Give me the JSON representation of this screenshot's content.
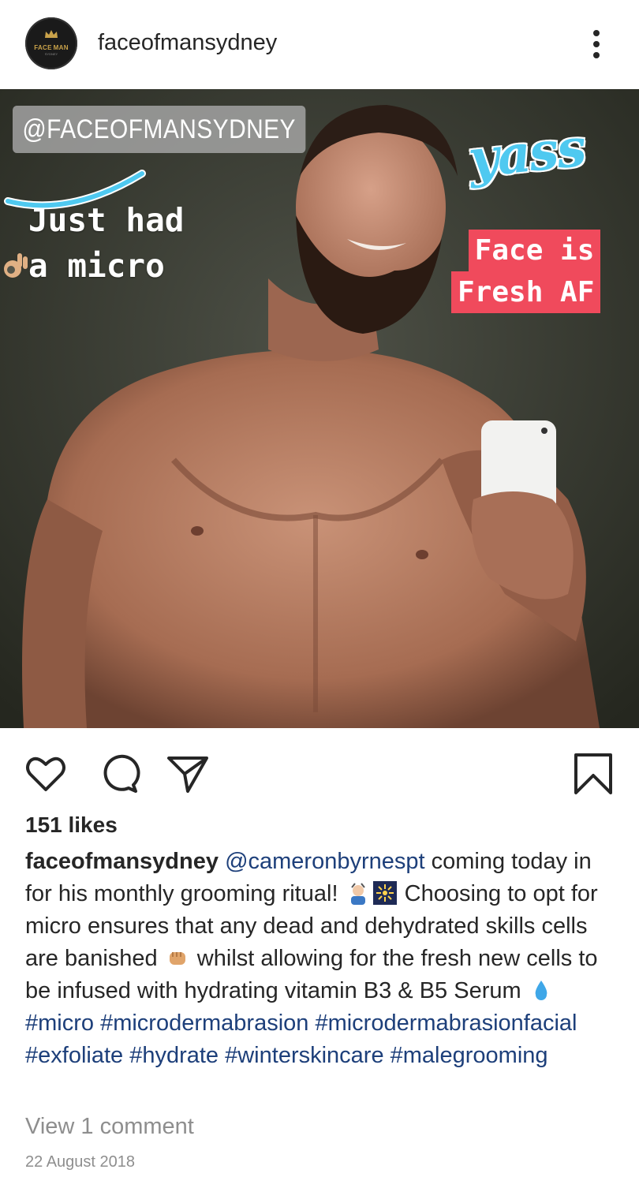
{
  "post": {
    "username": "faceofmansydney",
    "avatar_brand": "FACE MAN",
    "avatar_sub": "SYDNEY"
  },
  "photo": {
    "tag": "@FACEOFMANSYDNEY",
    "story_line1": "Just had",
    "story_line2": "a micro",
    "sticker": "yass",
    "badge_line1": "Face is",
    "badge_line2": "Fresh AF"
  },
  "icons": {
    "like": "heart-icon",
    "comment": "comment-icon",
    "share": "send-icon",
    "save": "bookmark-icon",
    "more": "more-vertical-icon"
  },
  "likes": "151 likes",
  "caption": {
    "user": "faceofmansydney",
    "mention": "@cameronbyrnespt",
    "text1": " coming today in for his monthly grooming ritual! ",
    "text2": " Choosing to opt for micro ensures that any dead and dehydrated skills cells are banished ",
    "text3": " whilst allowing for the fresh new cells to be infused with hydrating vitamin B3 & B5 Serum ",
    "hashtags": "#micro #microdermabrasion #microdermabrasionfacial #exfoliate #hydrate #winterskincare #malegrooming"
  },
  "view_comments": "View 1 comment",
  "date": "22 August 2018",
  "colors": {
    "link": "#1d3f7a",
    "badge": "#f04a5c",
    "sticker": "#4fc9f0",
    "meta": "#8e8e8e"
  }
}
